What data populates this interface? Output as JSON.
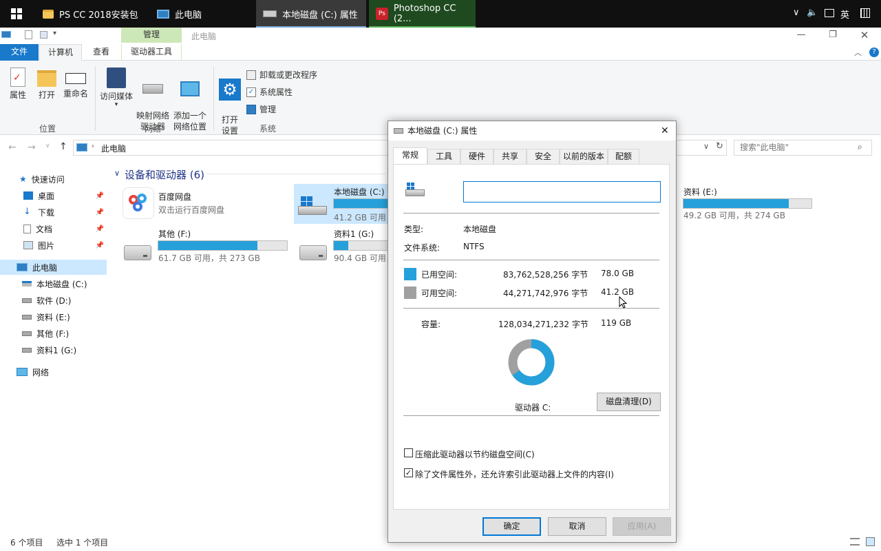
{
  "taskbar": {
    "items": [
      {
        "label": "PS CC 2018安装包",
        "icon": "folder-icon"
      },
      {
        "label": "此电脑",
        "icon": "pc-icon"
      },
      {
        "label": "本地磁盘 (C:) 属性",
        "icon": "drive-icon"
      },
      {
        "label": "Photoshop CC (2...",
        "icon": "photoshop-icon"
      }
    ],
    "tray": {
      "chevron": "∨",
      "volume": "🔈",
      "ime_lang": "英"
    }
  },
  "titlebar": {
    "title": "此电脑",
    "context_tab": "管理"
  },
  "ribbon_tabs": [
    "文件",
    "计算机",
    "查看",
    "驱动器工具"
  ],
  "ribbon": {
    "location": {
      "label": "位置",
      "buttons": [
        "属性",
        "打开",
        "重命名"
      ]
    },
    "network": {
      "label": "网络",
      "buttons": [
        "访问媒体",
        "映射网络\n驱动器",
        "添加一个\n网络位置"
      ]
    },
    "system": {
      "label": "系统",
      "open_settings": "打开\n设置",
      "small": [
        "卸载或更改程序",
        "系统属性",
        "管理"
      ]
    }
  },
  "address": {
    "path": "此电脑",
    "search_placeholder": "搜索\"此电脑\""
  },
  "nav": {
    "quick_access": "快速访问",
    "quick_items": [
      "桌面",
      "下载",
      "文档",
      "图片"
    ],
    "this_pc": "此电脑",
    "drives": [
      "本地磁盘 (C:)",
      "软件 (D:)",
      "资料 (E:)",
      "其他 (F:)",
      "资料1 (G:)"
    ],
    "network": "网络"
  },
  "content": {
    "group_title": "设备和驱动器 (6)",
    "items": [
      {
        "name": "百度网盘",
        "sub": "双击运行百度网盘"
      },
      {
        "name": "本地磁盘 (C:)",
        "sub": "41.2 GB 可用，共 119 GB",
        "used_pct": 65
      },
      {
        "name": "资料 (E:)",
        "sub": "49.2 GB 可用，共 274 GB",
        "used_pct": 82
      },
      {
        "name": "其他 (F:)",
        "sub": "61.7 GB 可用，共 273 GB",
        "used_pct": 77
      },
      {
        "name": "资料1 (G:)",
        "sub": "90.4 GB 可用，共 273 GB",
        "used_pct": 67
      }
    ]
  },
  "status": {
    "count": "6 个项目",
    "selected": "选中 1 个项目"
  },
  "dialog": {
    "title": "本地磁盘 (C:) 属性",
    "tabs": [
      "常规",
      "工具",
      "硬件",
      "共享",
      "安全",
      "以前的版本",
      "配额"
    ],
    "name_value": "",
    "type_label": "类型:",
    "type_value": "本地磁盘",
    "fs_label": "文件系统:",
    "fs_value": "NTFS",
    "used_label": "已用空间:",
    "used_bytes": "83,762,528,256 字节",
    "used_gb": "78.0 GB",
    "free_label": "可用空间:",
    "free_bytes": "44,271,742,976 字节",
    "free_gb": "41.2 GB",
    "cap_label": "容量:",
    "cap_bytes": "128,034,271,232 字节",
    "cap_gb": "119 GB",
    "used_fraction": 0.654,
    "drive_label": "驱动器 C:",
    "cleanup_button": "磁盘清理(D)",
    "compress_label": "压缩此驱动器以节约磁盘空间(C)",
    "compress_checked": false,
    "index_label": "除了文件属性外，还允许索引此驱动器上文件的内容(I)",
    "index_checked": true,
    "ok": "确定",
    "cancel": "取消",
    "apply": "应用(A)",
    "colors": {
      "used": "#26a0da",
      "free": "#a0a0a0"
    }
  }
}
